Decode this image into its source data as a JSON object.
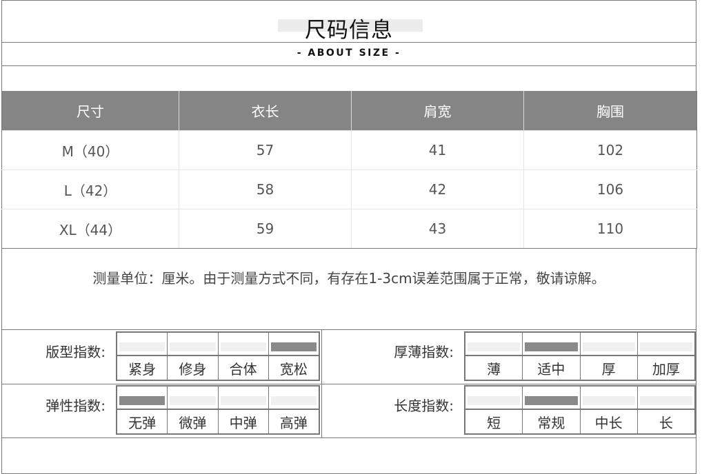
{
  "title": "尺码信息",
  "subtitle": "- ABOUT SIZE -",
  "table": {
    "headers": [
      "尺寸",
      "衣长",
      "肩宽",
      "胸围"
    ],
    "rows": [
      [
        "M（40）",
        "57",
        "41",
        "102"
      ],
      [
        "L（42）",
        "58",
        "42",
        "106"
      ],
      [
        "XL（44）",
        "59",
        "43",
        "110"
      ]
    ]
  },
  "note": "测量单位：厘米。由于测量方式不同，有存在1-3cm误差范围属于正常，敬请谅解。",
  "indices": {
    "fit": {
      "label": "版型指数:",
      "options": [
        "紧身",
        "修身",
        "合体",
        "宽松"
      ],
      "selected_index": 3
    },
    "thickness": {
      "label": "厚薄指数:",
      "options": [
        "薄",
        "适中",
        "厚",
        "加厚"
      ],
      "selected_index": 1
    },
    "elasticity": {
      "label": "弹性指数:",
      "options": [
        "无弹",
        "微弹",
        "中弹",
        "高弹"
      ],
      "selected_index": 0
    },
    "length": {
      "label": "长度指数:",
      "options": [
        "短",
        "常规",
        "中长",
        "长"
      ],
      "selected_index": 1
    }
  },
  "colors": {
    "header_bg": "#858585",
    "selected_fill": "#8a8a8a",
    "unselected_fill": "#f0f0f0"
  }
}
